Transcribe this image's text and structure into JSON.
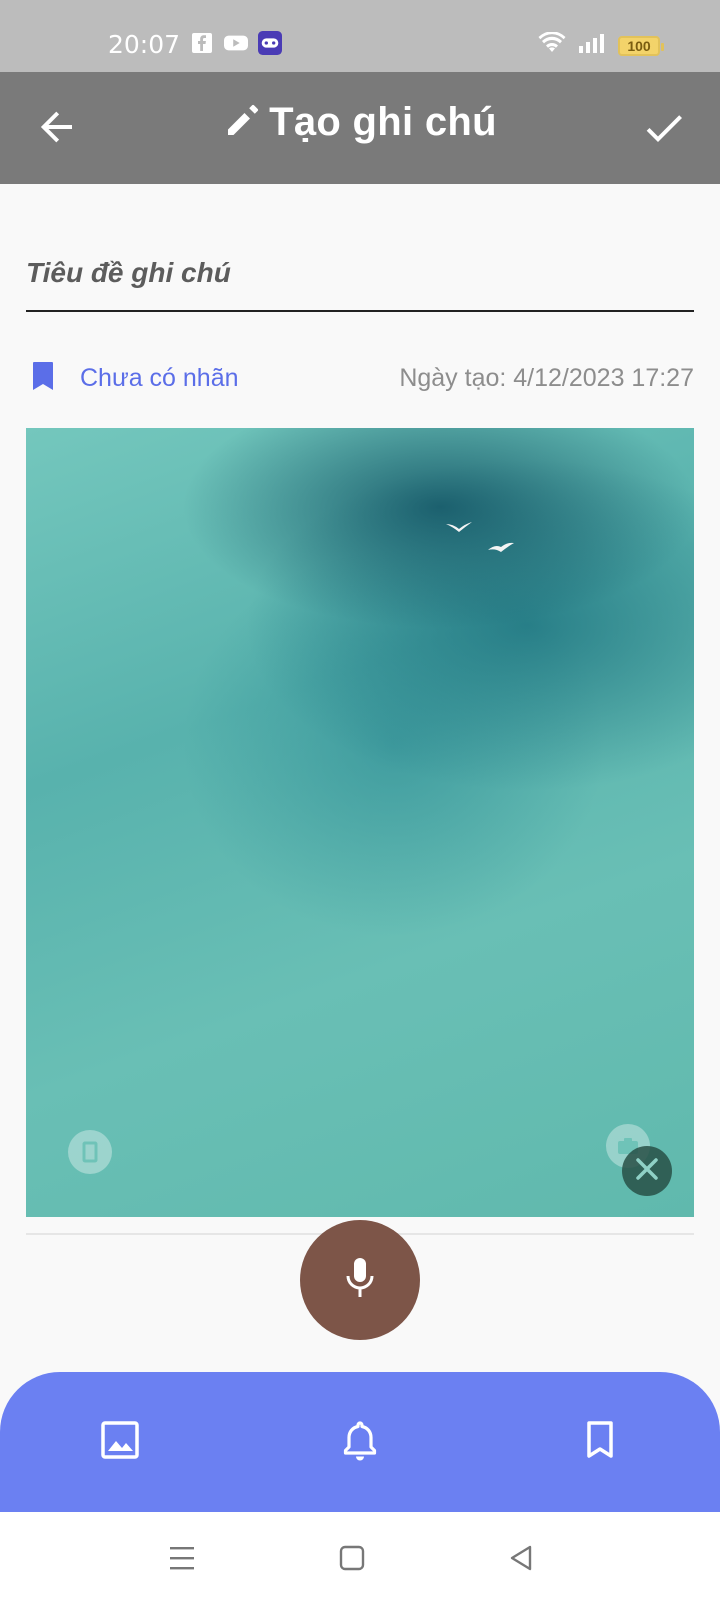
{
  "status_bar": {
    "time": "20:07",
    "battery": "100",
    "left_icons": [
      "facebook-icon",
      "youtube-icon",
      "game-icon"
    ],
    "right_icons": [
      "wifi-icon",
      "signal-icon",
      "battery-icon"
    ]
  },
  "app_bar": {
    "title": "Tạo ghi chú",
    "back_icon": "arrow-left-icon",
    "title_icon": "pencil-icon",
    "confirm_icon": "check-icon"
  },
  "note": {
    "title_placeholder": "Tiêu đề ghi chú",
    "title_value": "",
    "label_text": "Chưa có nhãn",
    "created_at": "Ngày tạo: 4/12/2023 17:27"
  },
  "toolbar": {
    "items": [
      "image-icon",
      "bell-icon",
      "bookmark-icon"
    ]
  },
  "nav_bar": {
    "items": [
      "menu-icon",
      "home-icon",
      "back-icon"
    ]
  },
  "colors": {
    "app_bar": "#7a7a7a",
    "accent": "#6b80f2",
    "label": "#5b6ee8",
    "mic_button": "#7d5548"
  }
}
